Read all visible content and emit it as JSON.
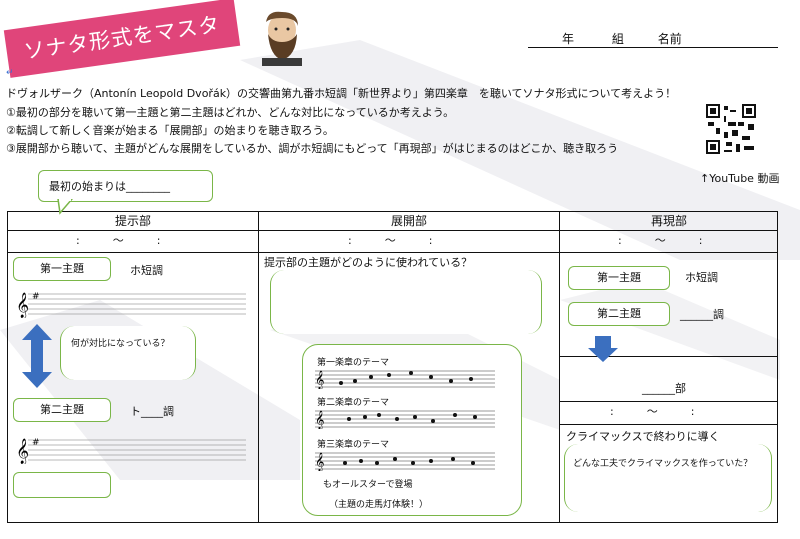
{
  "header": {
    "title": "ソナタ形式をマスター！",
    "year_label": "年",
    "class_label": "組",
    "name_label": "名前"
  },
  "intro": {
    "line1": "ドヴォルザーク（Antonín Leopold Dvořák）の交響曲第九番ホ短調「新世界より」第四楽章　を聴いてソナタ形式について考えよう！",
    "line2": "①最初の部分を聴いて第一主題と第二主題はどれか、どんな対比になっているか考えよう。",
    "line3": "②転調して新しく音楽が始まる「展開部」の始まりを聴き取ろう。",
    "line4": "③展開部から聴いて、主題がどんな展開をしているか、調がホ短調にもどって「再現部」がはじまるのはどこか、聴き取ろう"
  },
  "youtube_label": "↑YouTube 動画",
  "start_bubble": "最初の始まりは________",
  "return_mark": "↵",
  "columns": {
    "exposition": "提示部",
    "development": "展開部",
    "recapitulation": "再現部"
  },
  "time_placeholder": ":　　　〜　　　:",
  "exposition": {
    "theme1": "第一主題",
    "theme1_key": "ホ短調",
    "contrast_q": "何が対比になっている？",
    "theme2": "第二主題",
    "theme2_key": "ト____調"
  },
  "development": {
    "question": "提示部の主題がどのように使われている？",
    "mov1": "第一楽章のテーマ",
    "mov2": "第二楽章のテーマ",
    "mov3": "第三楽章のテーマ",
    "allstar": "もオールスターで登場",
    "allstar_sub": "（主題の走馬灯体験！）"
  },
  "recap": {
    "theme1": "第一主題",
    "theme1_key": "ホ短調",
    "theme2": "第二主題",
    "theme2_key": "______調",
    "coda_part": "______部",
    "climax": "クライマックスで終わりに導く",
    "climax_q": "どんな工夫でクライマックスを作っていた？"
  },
  "colors": {
    "banner": "#e0457a",
    "box_border": "#7ab648",
    "arrow": "#3b6fbf",
    "return_mark": "#3a6fd0"
  }
}
